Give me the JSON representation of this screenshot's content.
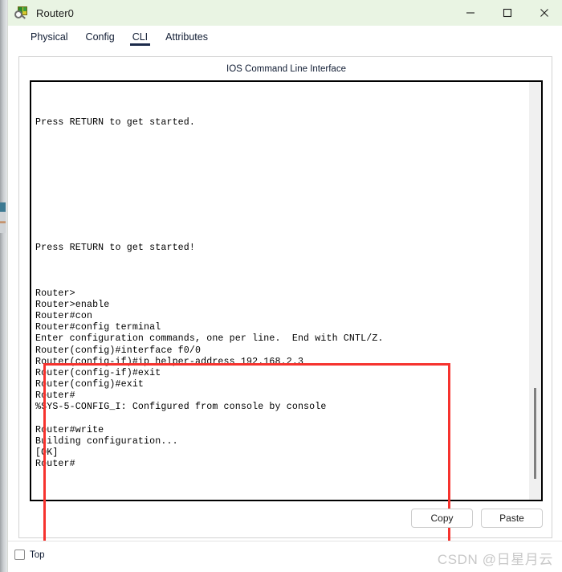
{
  "window": {
    "title": "Router0",
    "icon": "packet-tracer-router-icon",
    "controls": {
      "minimize": "Minimize",
      "maximize": "Maximize",
      "close": "Close"
    }
  },
  "tabs": [
    {
      "label": "Physical",
      "active": false
    },
    {
      "label": "Config",
      "active": false
    },
    {
      "label": "CLI",
      "active": true
    },
    {
      "label": "Attributes",
      "active": false
    }
  ],
  "cli": {
    "caption": "IOS Command Line Interface",
    "content": "\n\n\nPress RETURN to get started.\n\n\n\n\n\n\n\n\n\n\nPress RETURN to get started!\n\n\n\nRouter>\nRouter>enable\nRouter#con\nRouter#config terminal\nEnter configuration commands, one per line.  End with CNTL/Z.\nRouter(config)#interface f0/0\nRouter(config-if)#ip helper-address 192.168.2.3\nRouter(config-if)#exit\nRouter(config)#exit\nRouter#\n%SYS-5-CONFIG_I: Configured from console by console\n\nRouter#write\nBuilding configuration...\n[OK]\nRouter#",
    "scrollbar": {
      "thumb_position": "near-bottom"
    },
    "highlight_color": "#f6332e"
  },
  "actions": {
    "copy": "Copy",
    "paste": "Paste"
  },
  "statusbar": {
    "top_checkbox_label": "Top",
    "top_checked": false,
    "watermark": "CSDN @日星月云"
  }
}
